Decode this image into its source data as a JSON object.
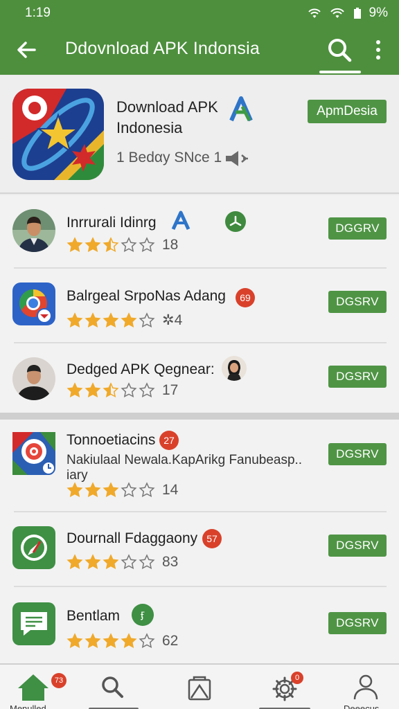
{
  "status_bar": {
    "time": "1:19",
    "battery": "9%"
  },
  "app_bar": {
    "title": "Ddovnload APK Indonsia"
  },
  "header": {
    "name": "Download APK Indonesia",
    "subtitle": "1 Bedαy SNce 1",
    "tag": "ApmDesia"
  },
  "apps": [
    {
      "title": "Inrrurali Idinrg",
      "rating": 2.5,
      "count": "18",
      "button": "DGGRV"
    },
    {
      "title": "Balrgeal SrpoNas Adang",
      "badge": "69",
      "rating": 4,
      "count": "4",
      "count_prefix": "✲",
      "button": "DGSRV"
    },
    {
      "title": "Dedged APK Qegnear:",
      "rating": 2.5,
      "count": "17",
      "button": "DGSRV"
    },
    {
      "title": "Tonnoetiacins",
      "badge": "27",
      "desc": "Nakiulaal Newala.KapArikg Fanubeasp..",
      "desc2": "iary",
      "rating": 3,
      "count": "14",
      "button": "DGSRV"
    },
    {
      "title": "Dournall Fdaggaony",
      "badge": "57",
      "rating": 3,
      "count": "83",
      "button": "DGSRV"
    },
    {
      "title": "Bentlam",
      "badge": "ӻ",
      "rating": 4,
      "count": "62",
      "button": "DGSRV"
    }
  ],
  "bottom_nav": [
    {
      "label": "Menulled",
      "badge": "73"
    },
    {
      "label": ""
    },
    {
      "label": ""
    },
    {
      "label": "",
      "badge": "0"
    },
    {
      "label": "Deeecus"
    }
  ],
  "colors": {
    "primary": "#4d8f3d",
    "button": "#4f9445",
    "star": "#f0a92a",
    "badge": "#d9412b"
  }
}
